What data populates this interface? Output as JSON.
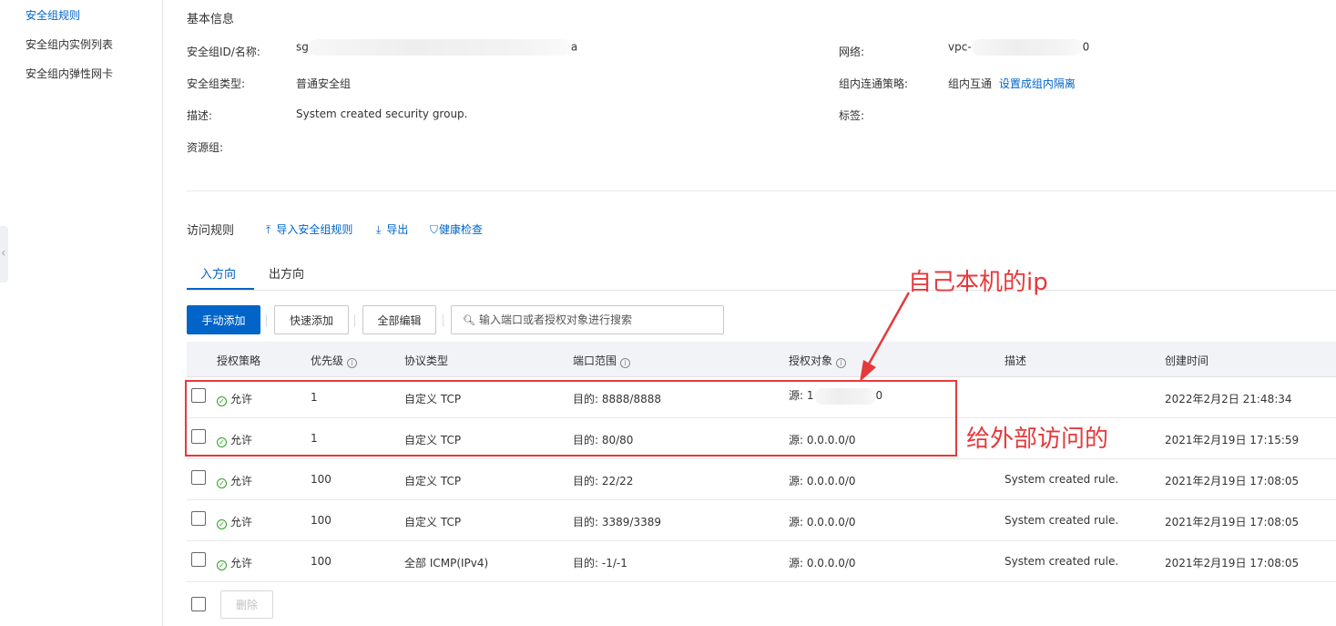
{
  "sidebar": {
    "items": [
      {
        "label": "安全组规则",
        "active": true
      },
      {
        "label": "安全组内实例列表",
        "active": false
      },
      {
        "label": "安全组内弹性网卡",
        "active": false
      }
    ],
    "collapse_icon": "chevron-left-icon"
  },
  "basic_info": {
    "title": "基本信息",
    "id_label": "安全组ID/名称:",
    "id_value_start": "sg",
    "id_value_end": "a",
    "type_label": "安全组类型:",
    "type_value": "普通安全组",
    "desc_label": "描述:",
    "desc_value": "System created security group.",
    "resource_group_label": "资源组:",
    "network_label": "网络:",
    "network_value_start": "vpc-",
    "network_value_end": "0",
    "policy_label": "组内连通策略:",
    "policy_value": "组内互通",
    "policy_link": "设置成组内隔离",
    "tags_label": "标签:"
  },
  "rules": {
    "title": "访问规则",
    "import_label": "导入安全组规则",
    "export_label": "导出",
    "health_label": "健康检查",
    "tabs": [
      {
        "label": "入方向",
        "active": true
      },
      {
        "label": "出方向",
        "active": false
      }
    ],
    "buttons": {
      "manual_add": "手动添加",
      "quick_add": "快速添加",
      "edit_all": "全部编辑",
      "delete": "删除"
    },
    "search_placeholder": "输入端口或者授权对象进行搜索",
    "columns": [
      "授权策略",
      "优先级",
      "协议类型",
      "端口范围",
      "授权对象",
      "描述",
      "创建时间"
    ],
    "rows": [
      {
        "policy": "允许",
        "priority": "1",
        "protocol": "自定义 TCP",
        "port": "目的: 8888/8888",
        "source_start": "源: 1",
        "source_end": "0",
        "masked": true,
        "desc": "",
        "time": "2022年2月2日 21:48:34"
      },
      {
        "policy": "允许",
        "priority": "1",
        "protocol": "自定义 TCP",
        "port": "目的: 80/80",
        "source": "源: 0.0.0.0/0",
        "desc": "",
        "time": "2021年2月19日 17:15:59"
      },
      {
        "policy": "允许",
        "priority": "100",
        "protocol": "自定义 TCP",
        "port": "目的: 22/22",
        "source": "源: 0.0.0.0/0",
        "desc": "System created rule.",
        "time": "2021年2月19日 17:08:05"
      },
      {
        "policy": "允许",
        "priority": "100",
        "protocol": "自定义 TCP",
        "port": "目的: 3389/3389",
        "source": "源: 0.0.0.0/0",
        "desc": "System created rule.",
        "time": "2021年2月19日 17:08:05"
      },
      {
        "policy": "允许",
        "priority": "100",
        "protocol": "全部 ICMP(IPv4)",
        "port": "目的: -1/-1",
        "source": "源: 0.0.0.0/0",
        "desc": "System created rule.",
        "time": "2021年2月19日 17:08:05"
      }
    ]
  },
  "annotations": {
    "own_ip": "自己本机的ip",
    "external": "给外部访问的",
    "color": "#e5393b"
  }
}
